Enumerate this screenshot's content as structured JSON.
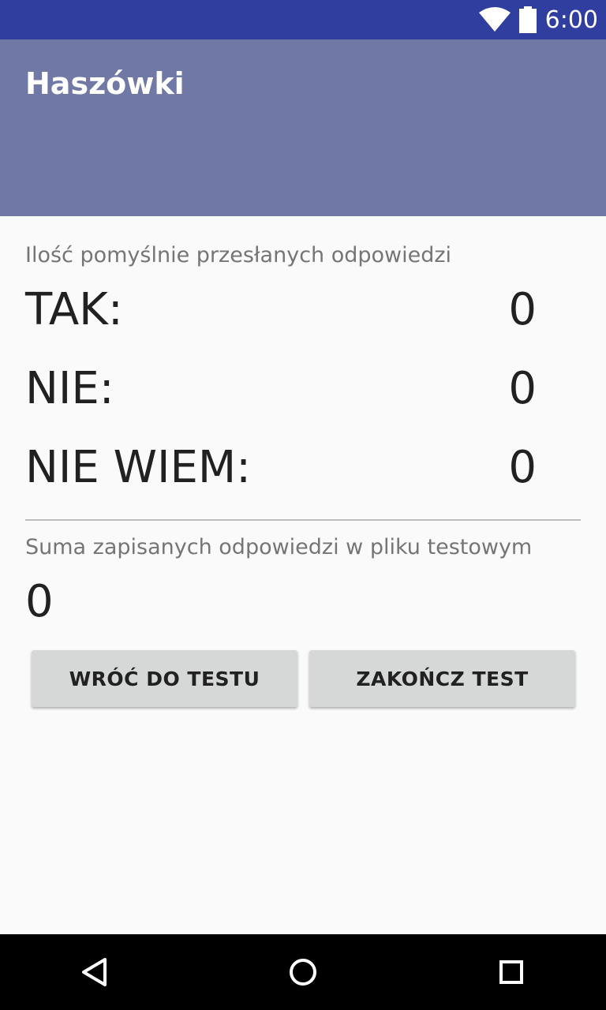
{
  "status_bar": {
    "time": "6:00",
    "icons": [
      "wifi-icon",
      "battery-icon"
    ]
  },
  "app_bar": {
    "title": "Haszówki",
    "color": "#7079a5",
    "status_color": "#303f9f"
  },
  "sent_section": {
    "caption": "Ilość pomyślnie przesłanych odpowiedzi",
    "rows": [
      {
        "label": "TAK:",
        "value": "0"
      },
      {
        "label": "NIE:",
        "value": "0"
      },
      {
        "label": "NIE WIEM:",
        "value": "0"
      }
    ]
  },
  "sum_section": {
    "caption": "Suma zapisanych odpowiedzi w pliku testowym",
    "value": "0"
  },
  "buttons": {
    "back_label": "WRÓĆ DO TESTU",
    "finish_label": "ZAKOŃCZ TEST"
  },
  "nav_bar": {
    "icons": [
      "back-icon",
      "home-icon",
      "recents-icon"
    ]
  }
}
